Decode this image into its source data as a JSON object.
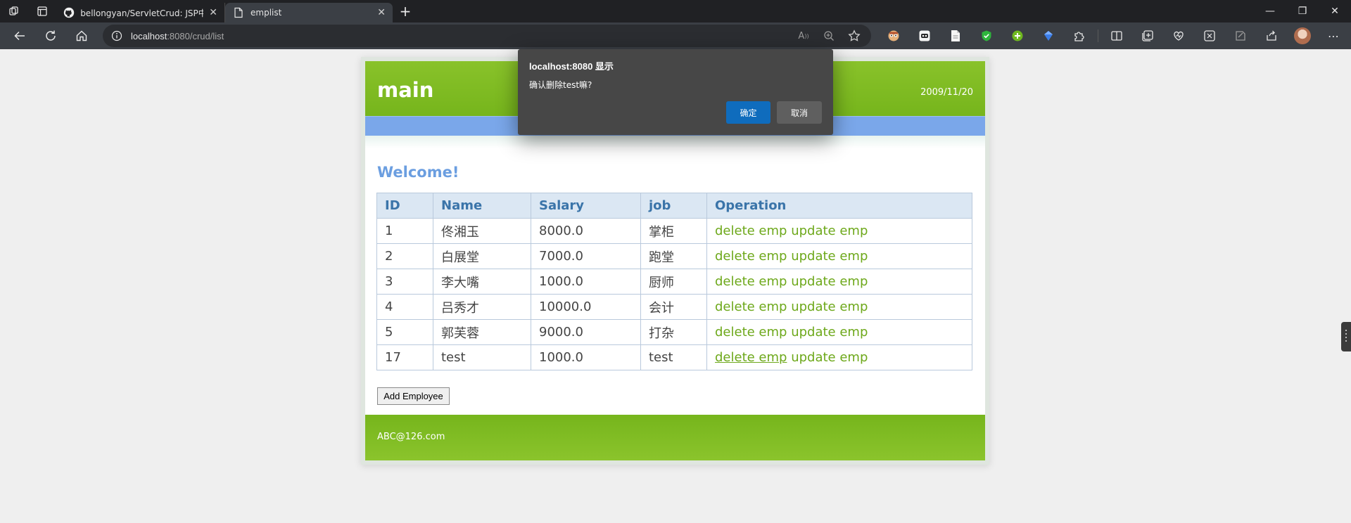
{
  "browser": {
    "tabs": [
      {
        "title": "bellongyan/ServletCrud: JSP中Se",
        "icon": "github-icon"
      },
      {
        "title": "emplist",
        "icon": "page-icon"
      }
    ],
    "url_host": "localhost",
    "url_rest": ":8080/crud/list"
  },
  "page": {
    "title": "main",
    "date": "2009/11/20",
    "welcome": "Welcome!",
    "table_headers": [
      "ID",
      "Name",
      "Salary",
      "job",
      "Operation"
    ],
    "rows": [
      {
        "id": "1",
        "name": "佟湘玉",
        "salary": "8000.0",
        "job": "掌柜"
      },
      {
        "id": "2",
        "name": "白展堂",
        "salary": "7000.0",
        "job": "跑堂"
      },
      {
        "id": "3",
        "name": "李大嘴",
        "salary": "1000.0",
        "job": "厨师"
      },
      {
        "id": "4",
        "name": "吕秀才",
        "salary": "10000.0",
        "job": "会计"
      },
      {
        "id": "5",
        "name": "郭芙蓉",
        "salary": "9000.0",
        "job": "打杂"
      },
      {
        "id": "17",
        "name": "test",
        "salary": "1000.0",
        "job": "test"
      }
    ],
    "delete_label": "delete emp",
    "update_label": "update emp",
    "add_button": "Add Employee",
    "footer_email": "ABC@126.com"
  },
  "dialog": {
    "title": "localhost:8080 显示",
    "message": "确认删除test嘛?",
    "ok_label": "确定",
    "cancel_label": "取消"
  },
  "colors": {
    "header_green": "#7ab820",
    "nav_blue": "#7aa7ea",
    "link_green": "#6da81a",
    "dialog_bg": "#474747",
    "ok_blue": "#0f6cbd"
  }
}
